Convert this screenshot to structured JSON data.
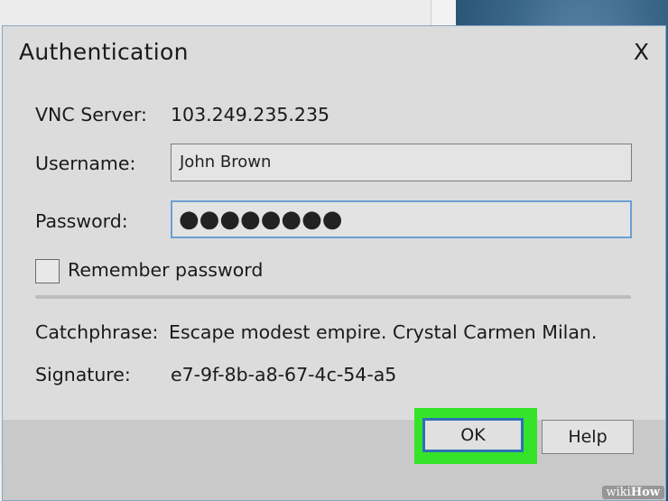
{
  "dialog": {
    "title": "Authentication",
    "close_label": "X"
  },
  "server": {
    "label": "VNC Server:",
    "value": "103.249.235.235"
  },
  "username": {
    "label": "Username:",
    "value": "John Brown"
  },
  "password": {
    "label": "Password:",
    "value": "●●●●●●●●"
  },
  "remember": {
    "label": "Remember password",
    "checked": false
  },
  "catchphrase": {
    "label": "Catchphrase:",
    "value": "Escape modest empire. Crystal Carmen Milan."
  },
  "signature": {
    "label": "Signature:",
    "value": "e7-9f-8b-a8-67-4c-54-a5"
  },
  "buttons": {
    "ok": "OK",
    "help": "Help"
  },
  "colors": {
    "highlight": "#35e32b",
    "focus": "#2f6fb5"
  },
  "watermark": "wikiHow"
}
